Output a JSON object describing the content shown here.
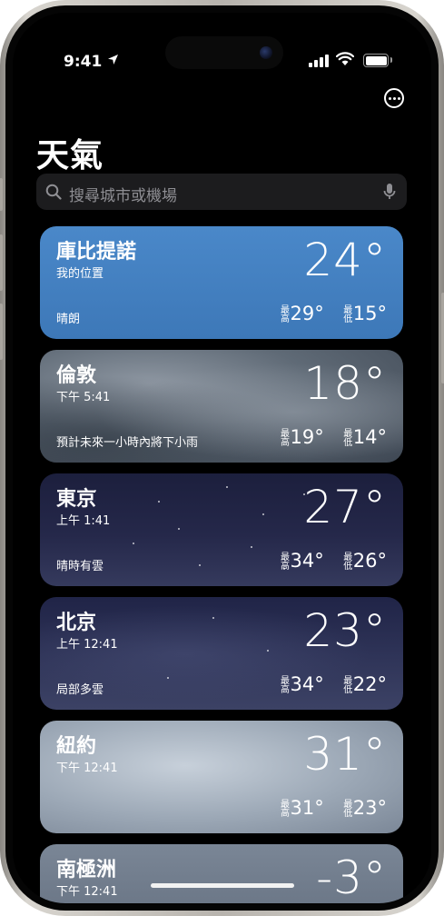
{
  "status_bar": {
    "time": "9:41"
  },
  "header": {
    "title": "天氣"
  },
  "search": {
    "placeholder": "搜尋城市或機場"
  },
  "cities": [
    {
      "name": "庫比提諾",
      "subtitle": "我的位置",
      "condition": "晴朗",
      "temp": "24°",
      "high_label": "最高",
      "high": "29°",
      "low_label": "最低",
      "low": "15°",
      "bg": "#3f7bbd"
    },
    {
      "name": "倫敦",
      "subtitle": "下午 5:41",
      "condition": "預計未來一小時內將下小雨",
      "temp": "18°",
      "high_label": "最高",
      "high": "19°",
      "low_label": "最低",
      "low": "14°",
      "bg": "#66717d"
    },
    {
      "name": "東京",
      "subtitle": "上午 1:41",
      "condition": "晴時有雲",
      "temp": "27°",
      "high_label": "最高",
      "high": "34°",
      "low_label": "最低",
      "low": "26°",
      "bg": "#25284a"
    },
    {
      "name": "北京",
      "subtitle": "上午 12:41",
      "condition": "局部多雲",
      "temp": "23°",
      "high_label": "最高",
      "high": "34°",
      "low_label": "最低",
      "low": "22°",
      "bg": "#2e3357"
    },
    {
      "name": "紐約",
      "subtitle": "下午 12:41",
      "condition": "",
      "temp": "31°",
      "high_label": "最高",
      "high": "31°",
      "low_label": "最低",
      "low": "23°",
      "bg": "#a4afbc"
    },
    {
      "name": "南極洲",
      "subtitle": "下午 12:41",
      "temp": "-3°",
      "bg": "#6d7888"
    }
  ]
}
